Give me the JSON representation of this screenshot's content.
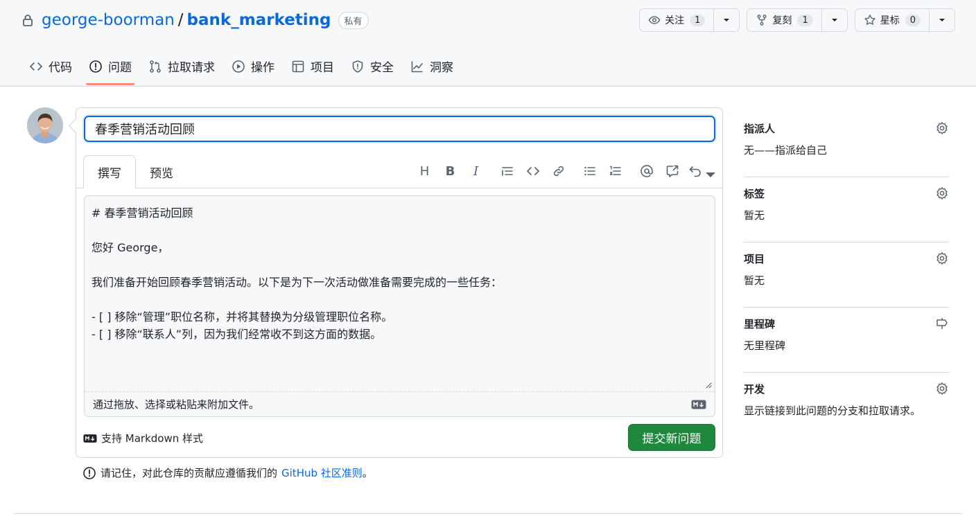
{
  "repo": {
    "owner": "george-boorman",
    "separator": "/",
    "name": "bank_marketing",
    "visibility": "私有"
  },
  "actions": {
    "watch": {
      "label": "关注",
      "count": "1"
    },
    "fork": {
      "label": "复刻",
      "count": "1"
    },
    "star": {
      "label": "星标",
      "count": "0"
    }
  },
  "nav": {
    "items": [
      {
        "label": "代码",
        "icon": "code-icon"
      },
      {
        "label": "问题",
        "icon": "issue-icon",
        "active": true
      },
      {
        "label": "拉取请求",
        "icon": "pull-request-icon"
      },
      {
        "label": "操作",
        "icon": "play-icon"
      },
      {
        "label": "项目",
        "icon": "table-icon"
      },
      {
        "label": "安全",
        "icon": "shield-icon"
      },
      {
        "label": "洞察",
        "icon": "graph-icon"
      }
    ]
  },
  "issue": {
    "title": "春季营销活动回顾",
    "tabs": {
      "write": "撰写",
      "preview": "预览"
    },
    "toolbar": {
      "heading": "H",
      "bold": "B",
      "italic": "I"
    },
    "body_lines": [
      "# 春季营销活动回顾",
      "",
      "您好 George，",
      "",
      "我们准备开始回顾春季营销活动。以下是为下一次活动做准备需要完成的一些任务：",
      "",
      "- [ ] 移除“管理”职位名称，并将其替换为分级管理职位名称。",
      "- [ ] 移除“联系人”列，因为我们经常收不到这方面的数据。"
    ],
    "attach_hint": "通过拖放、选择或粘贴来附加文件。",
    "markdown_note": "支持 Markdown 样式",
    "submit_label": "提交新问题",
    "guidelines_prefix": "请记住，对此仓库的贡献应遵循我们的",
    "guidelines_link": "GitHub 社区准则",
    "guidelines_suffix": "。"
  },
  "sidebar": {
    "assignees": {
      "label": "指派人",
      "value": "无——指派给自己"
    },
    "labels": {
      "label": "标签",
      "value": "暂无"
    },
    "projects": {
      "label": "项目",
      "value": "暂无"
    },
    "milestone": {
      "label": "里程碑",
      "value": "无里程碑"
    },
    "development": {
      "label": "开发",
      "value": "显示链接到此问题的分支和拉取请求。"
    }
  },
  "colors": {
    "accent": "#0969da",
    "submit": "#1f883d",
    "active_tab_underline": "#fd8c73"
  }
}
